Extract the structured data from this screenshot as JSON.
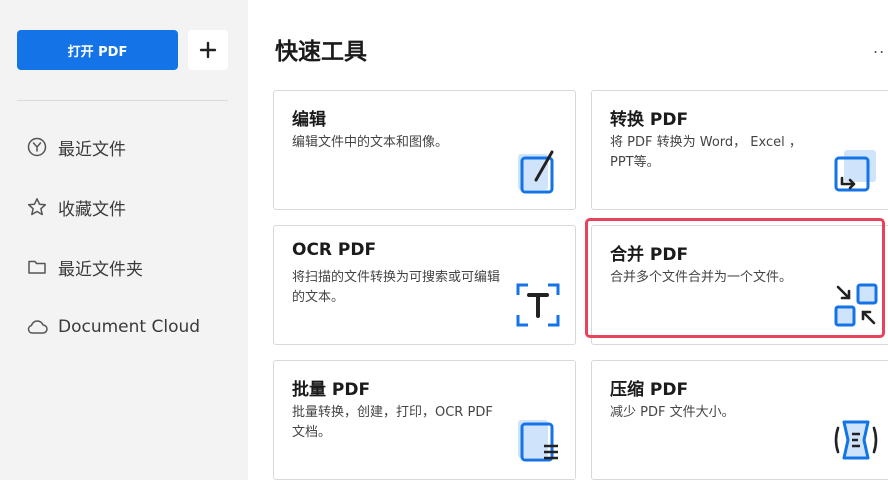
{
  "sidebar": {
    "open_button": "打开 PDF",
    "plus_label": "+",
    "items": [
      {
        "label": "最近文件",
        "icon": "clock-icon"
      },
      {
        "label": "收藏文件",
        "icon": "star-icon"
      },
      {
        "label": "最近文件夹",
        "icon": "folder-icon"
      },
      {
        "label": "Document Cloud",
        "icon": "cloud-icon"
      }
    ]
  },
  "main": {
    "title": "快速工具",
    "more": "..",
    "cards": [
      {
        "title": "编辑",
        "desc": "编辑文件中的文本和图像。",
        "icon": "edit-icon"
      },
      {
        "title": "转换 PDF",
        "desc": "将 PDF 转换为 Word， Excel ，PPT等。",
        "icon": "convert-icon"
      },
      {
        "title": "OCR PDF",
        "desc": "将扫描的文件转换为可搜索或可编辑的文本。",
        "icon": "ocr-icon"
      },
      {
        "title": "合并 PDF",
        "desc": "合并多个文件合并为一个文件。",
        "icon": "merge-icon"
      },
      {
        "title": "批量 PDF",
        "desc": "批量转换，创建，打印，OCR PDF 文档。",
        "icon": "batch-icon"
      },
      {
        "title": "压缩 PDF",
        "desc": "减少 PDF 文件大小。",
        "icon": "compress-icon"
      }
    ]
  },
  "colors": {
    "accent": "#1473e6",
    "highlight": "#e8435a",
    "sidebar_bg": "#f3f3f3"
  }
}
